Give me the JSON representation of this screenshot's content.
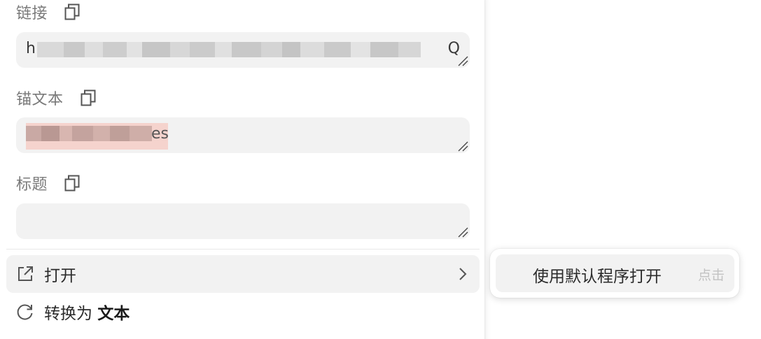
{
  "panel": {
    "fields": [
      {
        "label": "链接",
        "value_start": "h",
        "value_end": "Q",
        "copy_icon": "copy-icon"
      },
      {
        "label": "锚文本",
        "value_end": "es",
        "copy_icon": "copy-icon"
      },
      {
        "label": "标题",
        "value": "",
        "copy_icon": "copy-icon"
      }
    ],
    "menu": {
      "open": {
        "label": "打开",
        "icon": "external-link-icon",
        "chevron": "chevron-right-icon"
      },
      "convert": {
        "prefix": "转换为",
        "target": "文本",
        "icon": "refresh-icon"
      }
    }
  },
  "submenu": {
    "label": "使用默认程序打开",
    "hint": "点击"
  },
  "colors": {
    "field_bg": "#f2f2f2",
    "label": "#7a7a7a",
    "hint": "#c2c2c2",
    "highlight": "#f5d3cd"
  }
}
